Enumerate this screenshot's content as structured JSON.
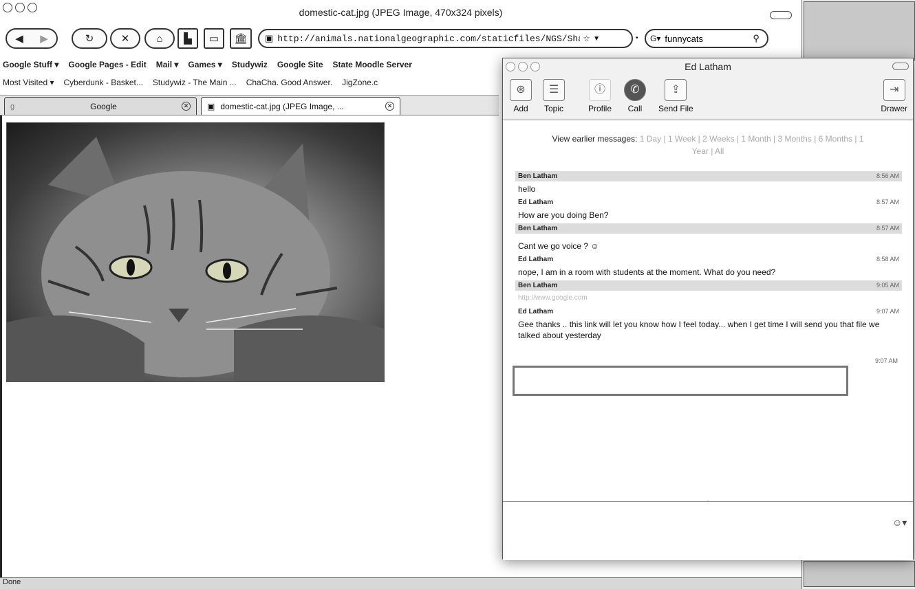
{
  "browser": {
    "window_title": "domestic-cat.jpg (JPEG Image, 470x324 pixels)",
    "url": "http://animals.nationalgeographic.com/staticfiles/NGS/Shared/S",
    "search_query": "funnycats",
    "bookmarks_row1": [
      "Google Stuff ▾",
      "Google Pages - Edit",
      "Mail ▾",
      "Games ▾",
      "Studywiz",
      "Google Site",
      "State Moodle Server"
    ],
    "bookmarks_row2": [
      "Most Visited ▾",
      "Cyberdunk - Basket...",
      "Studywiz - The Main ...",
      "ChaCha. Good Answer.",
      "JigZone.c"
    ],
    "tabs": [
      {
        "label": "Google",
        "active": false
      },
      {
        "label": "domestic-cat.jpg (JPEG Image, ...",
        "active": true
      }
    ],
    "status": "Done"
  },
  "chat": {
    "title": "Ed Latham",
    "toolbar": {
      "add": "Add",
      "topic": "Topic",
      "profile": "Profile",
      "call": "Call",
      "send_file": "Send File",
      "drawer": "Drawer"
    },
    "history_label": "View earlier messages:",
    "history_options": "1 Day | 1 Week | 2 Weeks | 1 Month | 3 Months | 6 Months | 1 Year | All",
    "messages": [
      {
        "sender": "Ben Latham",
        "time": "8:56 AM",
        "text": "hello",
        "shaded": true
      },
      {
        "sender": "Ed Latham",
        "time": "8:57 AM",
        "text": "How are you doing Ben?",
        "shaded": false
      },
      {
        "sender": "Ben Latham",
        "time": "8:57 AM",
        "text": "Cant we go voice ? ☺",
        "shaded": true
      },
      {
        "sender": "Ed Latham",
        "time": "8:58 AM",
        "text": "nope, I am in a room with students at the moment. What do you need?",
        "shaded": false
      },
      {
        "sender": "Ben Latham",
        "time": "9:05 AM",
        "text": "http://www.google.com",
        "shaded": true,
        "dim": true
      },
      {
        "sender": "Ed Latham",
        "time": "9:07 AM",
        "text": "Gee thanks .. this link will let you know how I feel today... when I get time I will send you that file we talked about yesterday",
        "shaded": false
      }
    ],
    "last_time": "9:07 AM"
  },
  "colors": {
    "border_dark": "#333333",
    "header_shade": "#dcdcdc",
    "highlight_border": "#777777"
  }
}
